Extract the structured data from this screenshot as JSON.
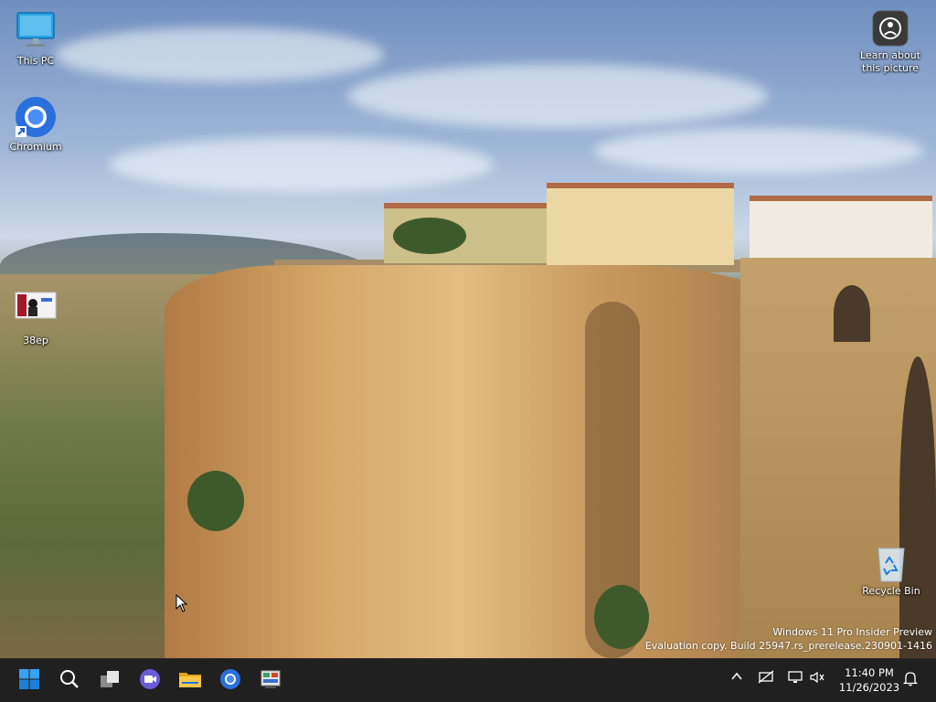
{
  "desktop": {
    "icons": [
      {
        "label": "This PC",
        "icon": "monitor-icon"
      },
      {
        "label": "Chromium",
        "icon": "chromium-icon"
      },
      {
        "label": "38ep",
        "icon": "image-file-icon"
      },
      {
        "label": "Learn about this picture",
        "icon": "camera-info-icon"
      },
      {
        "label": "Recycle Bin",
        "icon": "recycle-bin-icon"
      }
    ],
    "watermark": {
      "line1": "Windows 11 Pro Insider Preview",
      "line2": "Evaluation copy. Build 25947.rs_prerelease.230901-1416"
    }
  },
  "taskbar": {
    "apps": [
      {
        "name": "Start",
        "icon": "windows-start-icon"
      },
      {
        "name": "Search",
        "icon": "search-icon"
      },
      {
        "name": "Task View",
        "icon": "task-view-icon"
      },
      {
        "name": "Meet / Chat",
        "icon": "video-chat-icon"
      },
      {
        "name": "File Explorer",
        "icon": "folder-icon"
      },
      {
        "name": "Chromium",
        "icon": "chromium-icon"
      },
      {
        "name": "Control Panel app",
        "icon": "control-panel-icon"
      }
    ],
    "tray": {
      "chevron": "chevron-up-icon",
      "network": "network-off-icon",
      "display": "display-icon",
      "sound": "sound-muted-icon",
      "notifications": "bell-icon"
    },
    "clock": {
      "time": "11:40 PM",
      "date": "11/26/2023"
    }
  },
  "colors": {
    "taskbar_bg": "#202020",
    "accent_blue": "#0a7cd9",
    "chromium_blue": "#2a6fdb"
  }
}
